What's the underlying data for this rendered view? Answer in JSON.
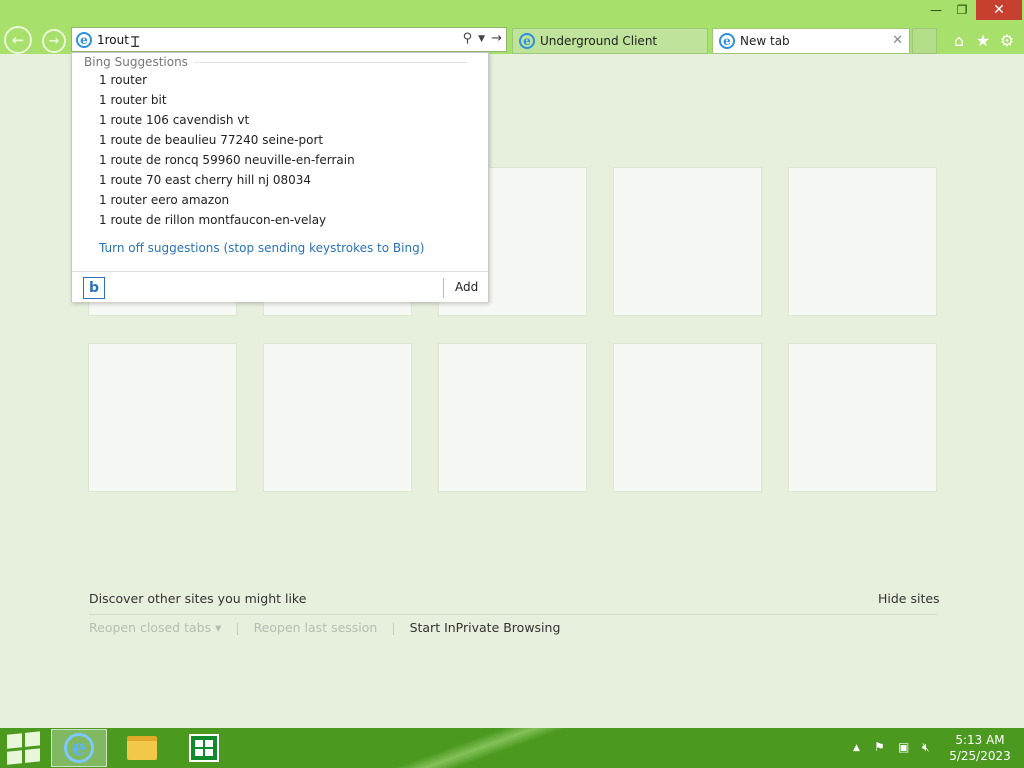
{
  "window": {
    "minimize_glyph": "—",
    "restore_glyph": "❐",
    "close_glyph": "✕"
  },
  "navigation": {
    "back_icon": "arrow-left-icon",
    "forward_icon": "arrow-right-icon"
  },
  "address_bar": {
    "value": "1rout",
    "icons": [
      "search-icon",
      "dropdown-icon",
      "go-arrow-icon"
    ]
  },
  "tabs": [
    {
      "label": "Underground Client",
      "active": false
    },
    {
      "label": "New tab",
      "active": true,
      "close": "✕"
    }
  ],
  "toolbar_icons": [
    "home-icon",
    "favorites-star-icon",
    "settings-gear-icon"
  ],
  "suggestions": {
    "header": "Bing Suggestions",
    "items": [
      "1 router",
      "1 router bit",
      "1 route 106 cavendish vt",
      "1 route de beaulieu 77240 seine-port",
      "1 route de roncq 59960 neuville-en-ferrain",
      "1 route 70 east cherry hill nj 08034",
      "1 router eero amazon",
      "1 route de rillon montfaucon-en-velay"
    ],
    "turn_off": "Turn off suggestions (stop sending keystrokes to Bing)",
    "provider_glyph": "b",
    "add_label": "Add"
  },
  "new_tab_page": {
    "discover": "Discover other sites you might like",
    "hide_sites": "Hide sites",
    "reopen_closed_tabs": "Reopen closed tabs ▾",
    "separator": "|",
    "reopen_last_session": "Reopen last session",
    "start_inprivate": "Start InPrivate Browsing"
  },
  "taskbar": {
    "apps": [
      "internet-explorer",
      "file-explorer",
      "windows-store"
    ],
    "tray_up": "▲",
    "clock_time": "5:13 AM",
    "clock_date": "5/25/2023"
  },
  "colors": {
    "chrome": "#a7e06a",
    "page_background": "#e7efdd",
    "taskbar": "#4b9a1f",
    "close_button": "#c7402f",
    "link": "#2a73b8"
  }
}
